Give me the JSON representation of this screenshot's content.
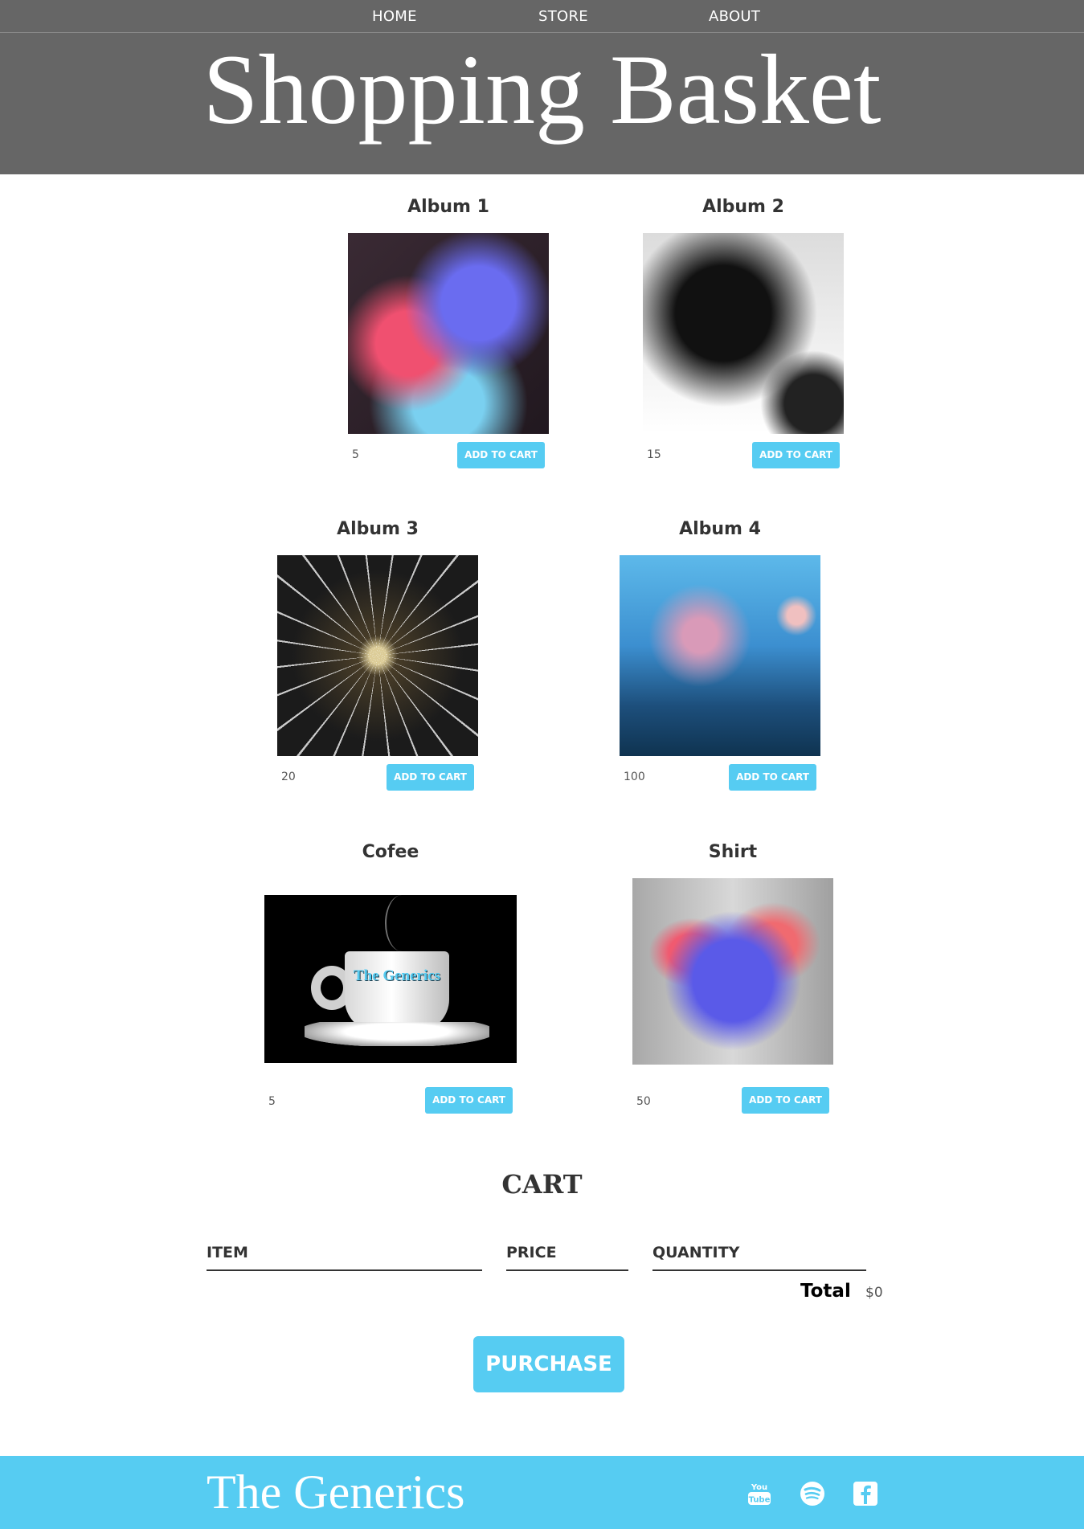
{
  "nav": {
    "home": "HOME",
    "store": "STORE",
    "about": "ABOUT"
  },
  "header": {
    "band_name": "Shopping Basket"
  },
  "items": [
    {
      "title": "Album 1",
      "price": "5",
      "button": "ADD TO CART",
      "image": "colorful-smoke-album-art"
    },
    {
      "title": "Album 2",
      "price": "15",
      "button": "ADD TO CART",
      "image": "black-ink-album-art"
    },
    {
      "title": "Album 3",
      "price": "20",
      "button": "ADD TO CART",
      "image": "radial-lights-album-art"
    },
    {
      "title": "Album 4",
      "price": "100",
      "button": "ADD TO CART",
      "image": "blue-bokeh-album-art"
    },
    {
      "title": "Cofee",
      "price": "5",
      "button": "ADD TO CART",
      "image": "coffee-cup",
      "image_text": "The Generics"
    },
    {
      "title": "Shirt",
      "price": "50",
      "button": "ADD TO CART",
      "image": "smoke-tshirt"
    }
  ],
  "cart": {
    "title": "CART",
    "columns": {
      "item": "ITEM",
      "price": "PRICE",
      "quantity": "QUANTITY"
    },
    "total_label": "Total",
    "total_value": "$0",
    "purchase_label": "PURCHASE"
  },
  "footer": {
    "band_name": "The Generics",
    "social_icons": [
      "youtube-icon",
      "spotify-icon",
      "facebook-icon"
    ]
  },
  "colors": {
    "header_bg": "#666666",
    "accent": "#56ccf2",
    "text": "#333333"
  }
}
